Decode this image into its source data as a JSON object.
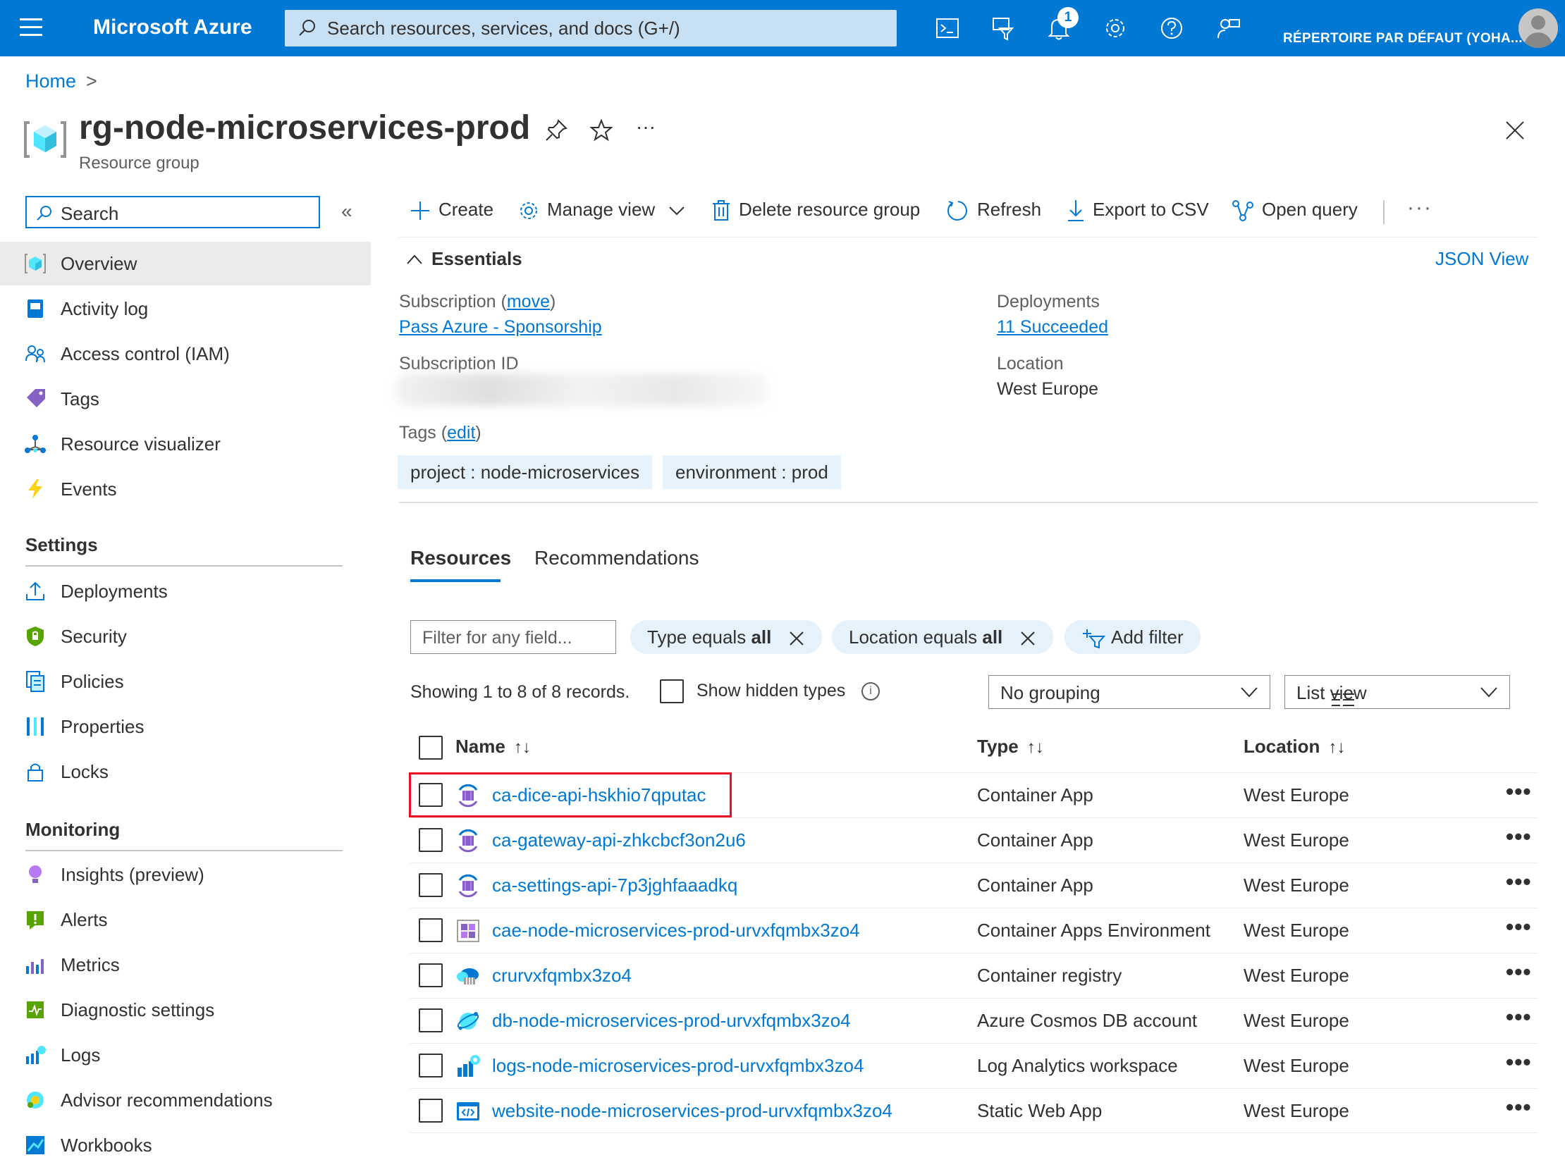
{
  "topbar": {
    "brand": "Microsoft Azure",
    "search_placeholder": "Search resources, services, and docs (G+/)",
    "notification_count": "1",
    "directory": "RÉPERTOIRE PAR DÉFAUT (YOHA...",
    "icons": [
      "cloud-shell-icon",
      "directory-filter-icon",
      "notifications-icon",
      "settings-icon",
      "help-icon",
      "feedback-icon"
    ]
  },
  "breadcrumb": {
    "home": "Home",
    "separator": ">"
  },
  "header": {
    "title": "rg-node-microservices-prod",
    "subtitle": "Resource group",
    "more": "···"
  },
  "sidebar": {
    "search_placeholder": "Search",
    "collapse": "«",
    "items": [
      {
        "label": "Overview",
        "icon": "resource-group-icon",
        "active": true
      },
      {
        "label": "Activity log",
        "icon": "activity-log-icon"
      },
      {
        "label": "Access control (IAM)",
        "icon": "iam-icon"
      },
      {
        "label": "Tags",
        "icon": "tag-icon"
      },
      {
        "label": "Resource visualizer",
        "icon": "visualizer-icon"
      },
      {
        "label": "Events",
        "icon": "events-icon"
      }
    ],
    "settings_heading": "Settings",
    "settings": [
      {
        "label": "Deployments",
        "icon": "deployments-icon"
      },
      {
        "label": "Security",
        "icon": "security-icon"
      },
      {
        "label": "Policies",
        "icon": "policies-icon"
      },
      {
        "label": "Properties",
        "icon": "properties-icon"
      },
      {
        "label": "Locks",
        "icon": "lock-icon"
      }
    ],
    "monitoring_heading": "Monitoring",
    "monitoring": [
      {
        "label": "Insights (preview)",
        "icon": "insights-icon"
      },
      {
        "label": "Alerts",
        "icon": "alerts-icon"
      },
      {
        "label": "Metrics",
        "icon": "metrics-icon"
      },
      {
        "label": "Diagnostic settings",
        "icon": "diagnostic-icon"
      },
      {
        "label": "Logs",
        "icon": "logs-icon"
      },
      {
        "label": "Advisor recommendations",
        "icon": "advisor-icon"
      },
      {
        "label": "Workbooks",
        "icon": "workbooks-icon"
      }
    ]
  },
  "commands": {
    "create": "Create",
    "manage_view": "Manage view",
    "delete": "Delete resource group",
    "refresh": "Refresh",
    "export": "Export to CSV",
    "open_query": "Open query",
    "more": "···"
  },
  "essentials": {
    "heading": "Essentials",
    "json_view": "JSON View",
    "subscription_label": "Subscription (",
    "subscription_move": "move",
    "subscription_close": ")",
    "subscription_value": "Pass Azure - Sponsorship",
    "subscription_id_label": "Subscription ID",
    "deployments_label": "Deployments",
    "deployments_value": "11 Succeeded",
    "location_label": "Location",
    "location_value": "West Europe",
    "tags_label": "Tags (",
    "tags_edit": "edit",
    "tags_close": ")",
    "tags": [
      "project : node-microservices",
      "environment : prod"
    ]
  },
  "tabs": {
    "resources": "Resources",
    "recommendations": "Recommendations"
  },
  "filters": {
    "placeholder": "Filter for any field...",
    "type_prefix": "Type equals ",
    "type_value": "all",
    "location_prefix": "Location equals ",
    "location_value": "all",
    "add_filter": "Add filter"
  },
  "list": {
    "showing": "Showing 1 to 8 of 8 records.",
    "show_hidden": "Show hidden types",
    "grouping": "No grouping",
    "view": "List view",
    "columns": {
      "name": "Name",
      "type": "Type",
      "location": "Location"
    }
  },
  "resources": [
    {
      "name": "ca-dice-api-hskhio7qputac",
      "type": "Container App",
      "location": "West Europe",
      "icon": "container-app-icon"
    },
    {
      "name": "ca-gateway-api-zhkcbcf3on2u6",
      "type": "Container App",
      "location": "West Europe",
      "icon": "container-app-icon"
    },
    {
      "name": "ca-settings-api-7p3jghfaaadkq",
      "type": "Container App",
      "location": "West Europe",
      "icon": "container-app-icon"
    },
    {
      "name": "cae-node-microservices-prod-urvxfqmbx3zo4",
      "type": "Container Apps Environment",
      "location": "West Europe",
      "icon": "container-apps-environment-icon"
    },
    {
      "name": "crurvxfqmbx3zo4",
      "type": "Container registry",
      "location": "West Europe",
      "icon": "container-registry-icon"
    },
    {
      "name": "db-node-microservices-prod-urvxfqmbx3zo4",
      "type": "Azure Cosmos DB account",
      "location": "West Europe",
      "icon": "cosmos-db-icon"
    },
    {
      "name": "logs-node-microservices-prod-urvxfqmbx3zo4",
      "type": "Log Analytics workspace",
      "location": "West Europe",
      "icon": "log-analytics-icon"
    },
    {
      "name": "website-node-microservices-prod-urvxfqmbx3zo4",
      "type": "Static Web App",
      "location": "West Europe",
      "icon": "static-web-app-icon"
    }
  ],
  "row_more": "•••",
  "colors": {
    "accent": "#0078d4",
    "highlight": "#e81123",
    "chip": "#e5f1fb"
  }
}
